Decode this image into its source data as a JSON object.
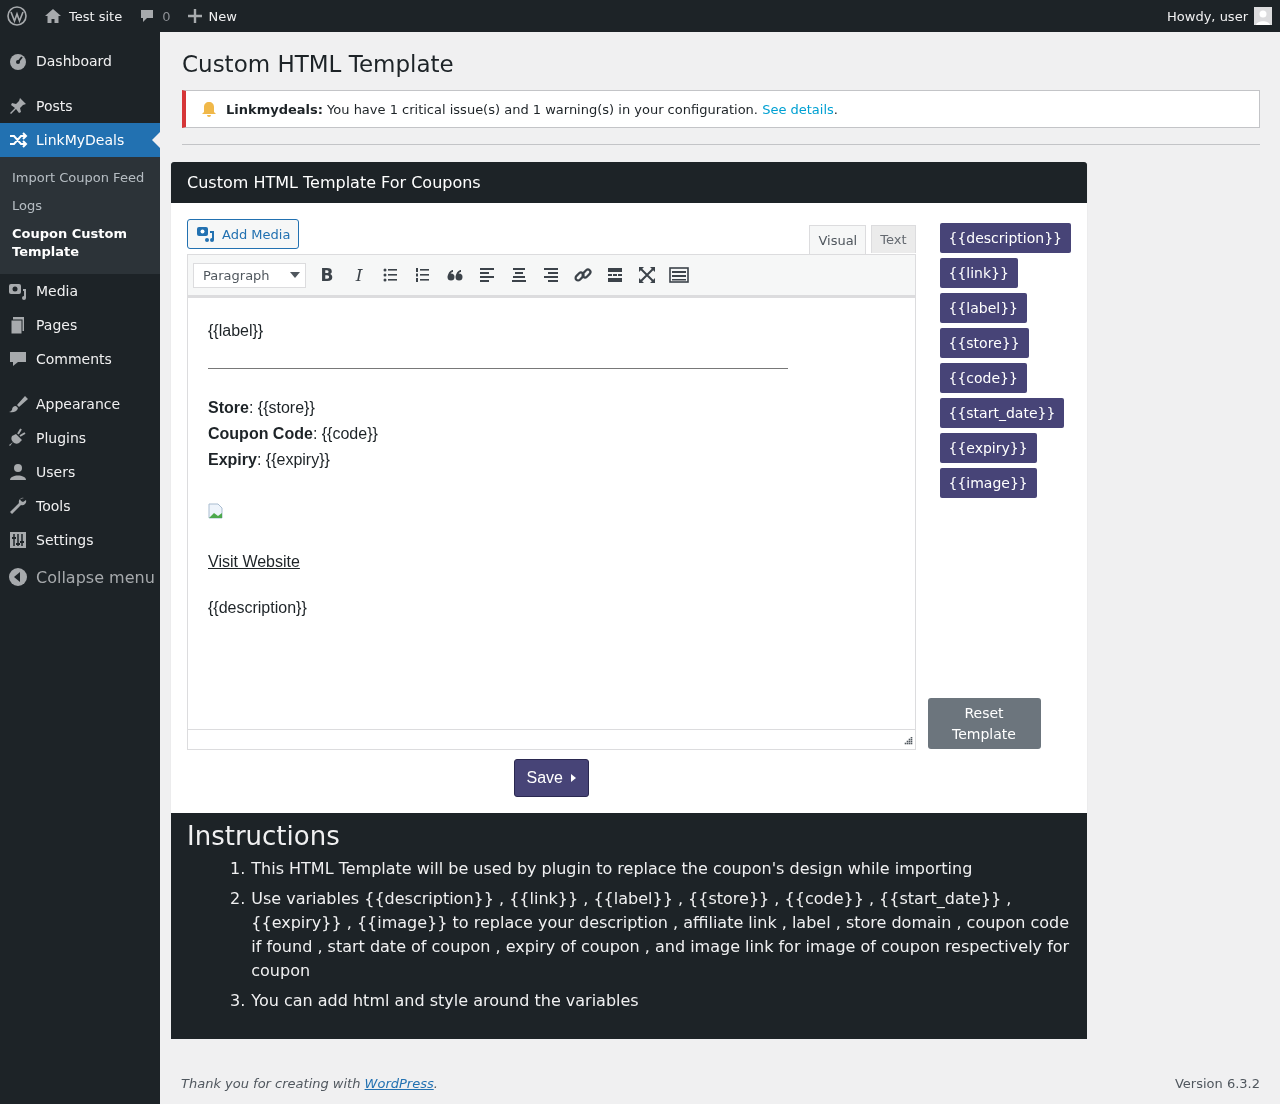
{
  "admin_bar": {
    "site": "Test site",
    "comments": "0",
    "new": "New",
    "greeting": "Howdy, user"
  },
  "sidebar": {
    "groups": [
      [
        {
          "label": "Dashboard",
          "selected": false
        }
      ],
      [
        {
          "label": "Posts",
          "selected": false
        },
        {
          "label": "LinkMyDeals",
          "selected": true,
          "children": [
            {
              "label": "Import Coupon Feed",
              "selected": false
            },
            {
              "label": "Logs",
              "selected": false
            },
            {
              "label": "Coupon Custom Template",
              "selected": true
            }
          ]
        },
        {
          "label": "Media",
          "selected": false
        },
        {
          "label": "Pages",
          "selected": false
        },
        {
          "label": "Comments",
          "selected": false
        }
      ],
      [
        {
          "label": "Appearance",
          "selected": false
        },
        {
          "label": "Plugins",
          "selected": false
        },
        {
          "label": "Users",
          "selected": false
        },
        {
          "label": "Tools",
          "selected": false
        },
        {
          "label": "Settings",
          "selected": false
        }
      ]
    ],
    "collapse": "Collapse menu"
  },
  "page_title": "Custom HTML Template",
  "notice": {
    "message": "**Linkmydeals:** You have 1 critical issue(s) and 1 warning(s) in your configuration.",
    "link": "See details",
    "suffix": "."
  },
  "template_panel": {
    "title": "Custom HTML Template For Coupons",
    "add_media": "Add Media",
    "editor_tabs": [
      {
        "label": "Visual",
        "selected": true
      },
      {
        "label": "Text",
        "selected": false
      }
    ],
    "format": "Paragraph",
    "toolbar": [
      {
        "kind": "bold",
        "label": "B"
      },
      {
        "kind": "italic",
        "label": "I"
      },
      {
        "kind": "bullets"
      },
      {
        "kind": "numbers"
      },
      {
        "kind": "quote"
      },
      {
        "kind": "align-left"
      },
      {
        "kind": "align-center"
      },
      {
        "kind": "align-right"
      },
      {
        "kind": "link"
      },
      {
        "kind": "more"
      },
      {
        "kind": "fullscreen"
      },
      {
        "kind": "keyboard"
      }
    ],
    "content": {
      "heading": "{{label}}",
      "fields": [
        "**Store**: {{store}}",
        "**Coupon Code**: {{code}}",
        "**Expiry**: {{expiry}}"
      ],
      "link": "Visit Website",
      "description": "{{description}}"
    },
    "variables": [
      "{{description}}",
      "{{link}}",
      "{{label}}",
      "{{store}}",
      "{{code}}",
      "{{start_date}}",
      "{{expiry}}",
      "{{image}}"
    ],
    "reset": "Reset Template",
    "save": "Save"
  },
  "instructions": {
    "title": "Instructions",
    "items": [
      {
        "number": "1.",
        "text": "This HTML Template will be used by plugin to replace the coupon's design while importing"
      },
      {
        "number": "2.",
        "text": "Use variables {{description}} , {{link}} , {{label}} , {{store}} , {{code}} , {{start_date}} , {{expiry}} , {{image}} to replace your description , affiliate link , label , store domain , coupon code if found , start date of coupon , expiry of coupon , and image link for image of coupon respectively for coupon"
      },
      {
        "number": "3.",
        "text": "You can add html and style around the variables"
      }
    ]
  },
  "footer": {
    "before": "Thank you for creating with ",
    "link": "WordPress",
    "after": ".",
    "version": "Version 6.3.2"
  }
}
